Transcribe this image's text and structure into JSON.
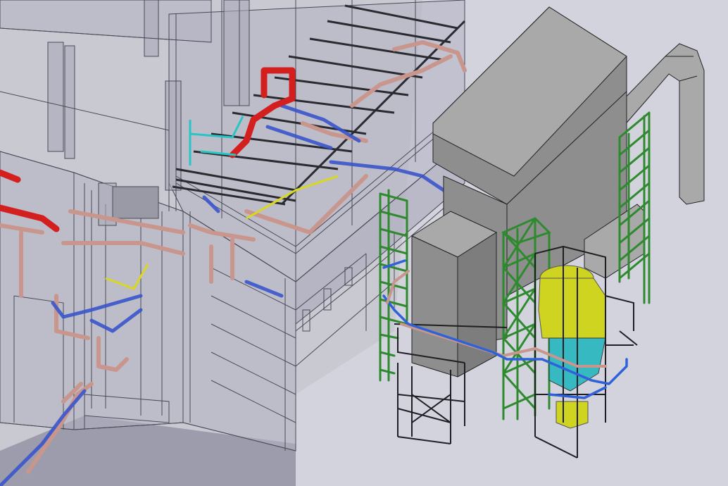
{
  "viewport": {
    "content": "cad-3d-model",
    "colors": {
      "background": "#c9c9d2",
      "floor": "#d2d2dc",
      "wireframe": "#3a3a44",
      "glass_fill": "#b4b4c4",
      "equipment_gray": "#8e8e8e",
      "equipment_light": "#a9a9a9",
      "structure_green": "#2f8a2f",
      "pipe_copper": "#c8968c",
      "pipe_blue": "#3a55cc",
      "pipe_red": "#d41f1f",
      "pipe_cyan": "#29c5c5",
      "tank_yellow": "#cfd420",
      "rail_dark": "#2a2a30"
    }
  }
}
